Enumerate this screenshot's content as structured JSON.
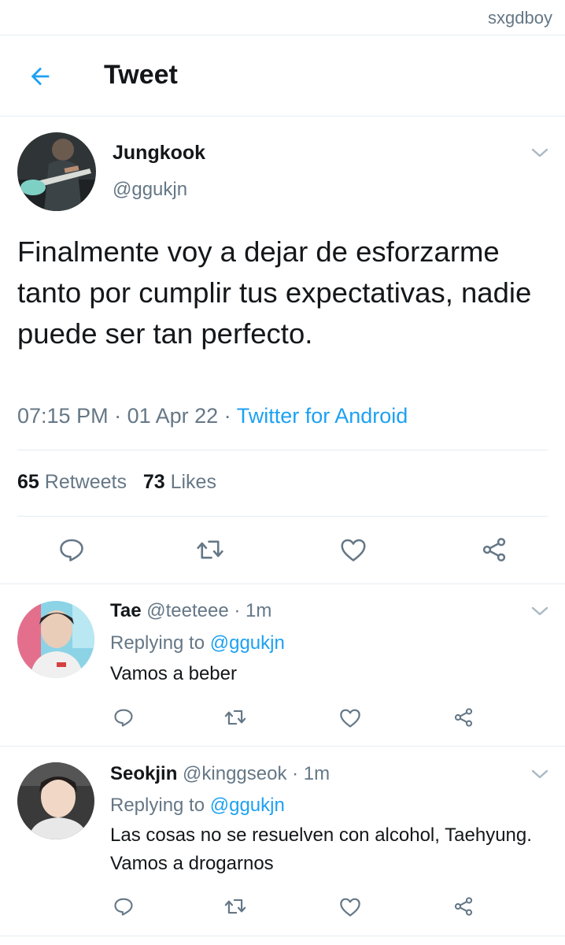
{
  "watermark": "sxgdboy",
  "header": {
    "title": "Tweet"
  },
  "main_tweet": {
    "name": "Jungkook",
    "handle": "@ggukjn",
    "text": "Finalmente voy a dejar de esforzarme tanto por cumplir tus expectativas, nadie puede ser tan perfecto.",
    "time": "07:15 PM",
    "sep1": " · ",
    "date": "01 Apr 22",
    "sep2": " · ",
    "source": "Twitter for Android",
    "retweets_count": "65",
    "retweets_label": " Retweets",
    "likes_count": "73",
    "likes_label": " Likes"
  },
  "replies": [
    {
      "name": "Tae",
      "handle_time": " @teeteee · 1m",
      "replying_label": "Replying to ",
      "replying_to": "@ggukjn",
      "text": "Vamos a beber"
    },
    {
      "name": "Seokjin",
      "handle_time": " @kinggseok · 1m",
      "replying_label": "Replying to ",
      "replying_to": "@ggukjn",
      "text": "Las cosas no se resuelven con alcohol, Taehyung. Vamos a drogarnos"
    }
  ],
  "icons": {
    "accent": "#1da1f2",
    "icon_gray": "#657786",
    "back": "arrow-left-icon",
    "reply": "reply-icon",
    "retweet": "retweet-icon",
    "like": "heart-icon",
    "share": "share-icon",
    "more": "chevron-down-icon"
  }
}
